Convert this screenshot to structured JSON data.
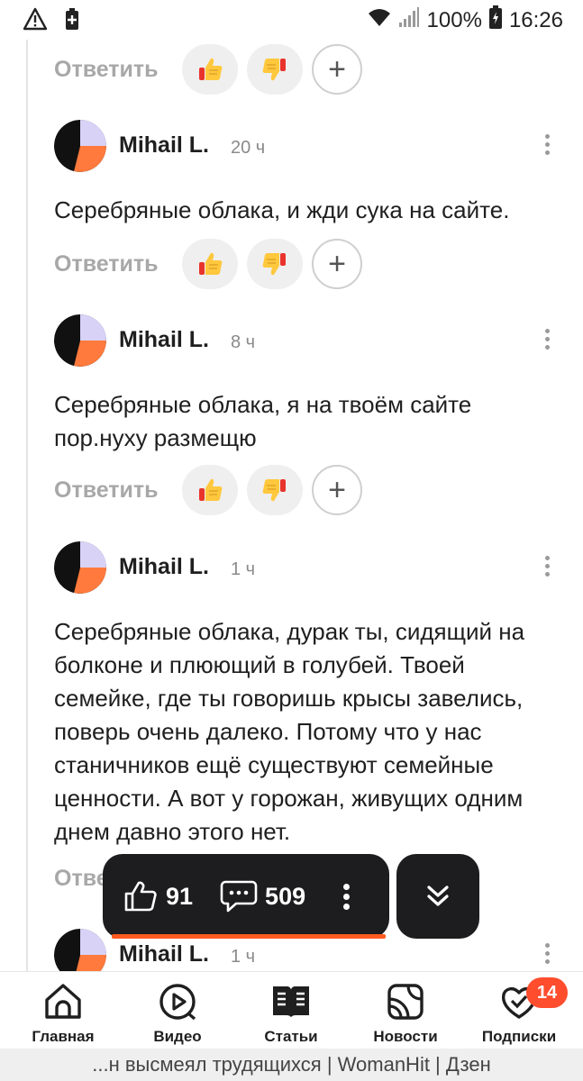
{
  "status_bar": {
    "battery_percent": "100%",
    "time": "16:26",
    "icons": [
      "warning-icon",
      "battery-saver-icon",
      "wifi-icon",
      "signal-icon",
      "battery-icon"
    ]
  },
  "actions": {
    "reply_label": "Ответить",
    "like_icon": "thumbs-up-icon",
    "dislike_icon": "thumbs-down-icon",
    "add_reaction_icon": "plus-icon",
    "partial_reply_label": "Отве"
  },
  "comments": [
    {
      "author": "Mihail L.",
      "time": "20 ч",
      "text": "Серебряные облака, и жди сука на сайте."
    },
    {
      "author": "Mihail L.",
      "time": "8 ч",
      "text": "Серебряные облака, я на твоём сайте пор.нуху размещю"
    },
    {
      "author": "Mihail L.",
      "time": "1 ч",
      "text": "Серебряные облака, дурак ты, сидящий на болконе и плюющий в голубей. Твоей семейке, где ты говоришь крысы завелись, поверь очень далеко. Потому что у нас станичников ещё существуют семейные ценности. А вот у горожан, живущих одним днем давно этого нет."
    },
    {
      "author": "Mihail L.",
      "time": "1 ч",
      "text": ""
    }
  ],
  "float_bar": {
    "likes_count": "91",
    "comments_count": "509",
    "accent_color": "#ff5a1f"
  },
  "bottom_nav": {
    "items": [
      {
        "label": "Главная",
        "icon": "home-icon"
      },
      {
        "label": "Видео",
        "icon": "video-icon"
      },
      {
        "label": "Статьи",
        "icon": "articles-icon"
      },
      {
        "label": "Новости",
        "icon": "news-icon"
      },
      {
        "label": "Подписки",
        "icon": "subscriptions-icon",
        "badge": "14"
      }
    ]
  },
  "browser": {
    "page_title": "...н высмеял трудящихся | WomanHit | Дзен"
  }
}
